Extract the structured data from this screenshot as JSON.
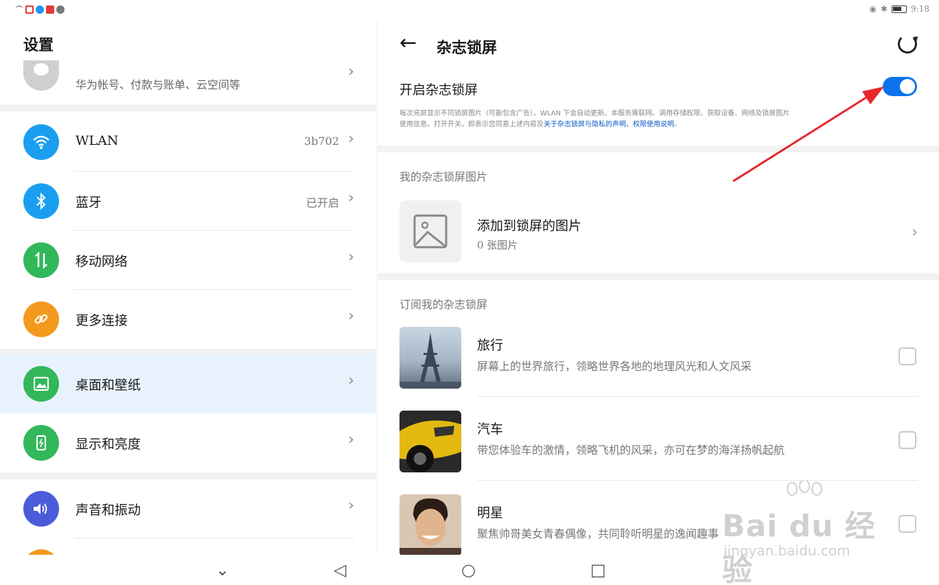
{
  "status": {
    "time": "9:18"
  },
  "left": {
    "title": "设置",
    "account_subtitle": "华为帐号、付款与账单、云空间等",
    "items": [
      {
        "label": "WLAN",
        "value": "3b702",
        "color": "#1a9ff0"
      },
      {
        "label": "蓝牙",
        "value": "已开启",
        "color": "#1a9ff0"
      },
      {
        "label": "移动网络",
        "value": "",
        "color": "#32b75b"
      },
      {
        "label": "更多连接",
        "value": "",
        "color": "#f39a1e"
      },
      {
        "label": "桌面和壁纸",
        "value": "",
        "color": "#32b75b"
      },
      {
        "label": "显示和亮度",
        "value": "",
        "color": "#32b75b"
      },
      {
        "label": "声音和振动",
        "value": "",
        "color": "#4c5bd9"
      }
    ],
    "chevron": "›"
  },
  "right": {
    "back": "←",
    "title": "杂志锁屏",
    "toggle_label": "开启杂志锁屏",
    "toggle_on": true,
    "desc_line1": "每次亮屏显示不同锁屏图片（可能包含广告）。WLAN 下会自动更新。本服务需联网、调用存储权限、获取设备、网络及锁屏图片",
    "desc_line2_a": "使用信息。打开开关，即表示您同意上述内容及",
    "desc_link": "关于杂志锁屏与隐私的声明、权限使用说明",
    "desc_line2_b": "。",
    "my_section": "我的杂志锁屏图片",
    "add_title": "添加到锁屏的图片",
    "add_sub": "0 张图片",
    "sub_section": "订阅我的杂志锁屏",
    "subs": [
      {
        "title": "旅行",
        "desc": "屏幕上的世界旅行，领略世界各地的地理风光和人文风采"
      },
      {
        "title": "汽车",
        "desc": "带您体验车的激情，领略飞机的风采，亦可在梦的海洋扬帆起航"
      },
      {
        "title": "明星",
        "desc": "聚焦帅哥美女青春偶像，共同聆听明星的逸闻趣事"
      }
    ]
  },
  "nav": {
    "down": "⌄",
    "back": "◁",
    "home": "○",
    "recent": "□"
  },
  "watermark": {
    "brand": "Bai du 经验",
    "url": "jingyan.baidu.com"
  },
  "accent": "#0a73eb",
  "arrow_color": "#e8262b"
}
